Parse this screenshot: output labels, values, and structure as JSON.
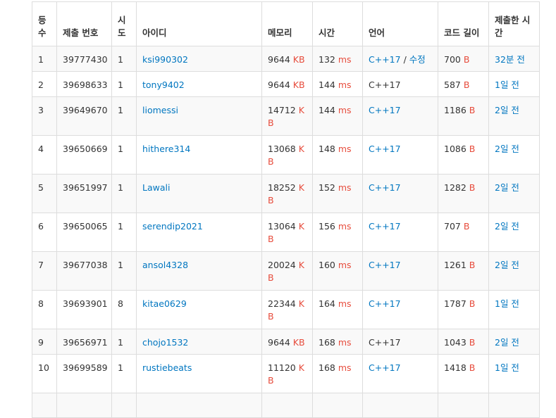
{
  "headers": [
    "등수",
    "제출 번호",
    "시도",
    "아이디",
    "메모리",
    "시간",
    "언어",
    "코드 길이",
    "제출한 시간"
  ],
  "header_lines": {
    "rank": [
      "등",
      "수"
    ],
    "attempt": [
      "시",
      "도"
    ],
    "time": [
      "제출한 시",
      "간"
    ]
  },
  "units": {
    "memory": "KB",
    "time": "ms",
    "code": "B"
  },
  "rows": [
    {
      "rank": "1",
      "submission": "39777430",
      "attempts": "1",
      "user": "ksi990302",
      "memory": "9644",
      "time": "132",
      "language": "C++17",
      "lang_linked": true,
      "edit_label": "수정",
      "code_length": "700",
      "submitted": "32분 전"
    },
    {
      "rank": "2",
      "submission": "39698633",
      "attempts": "1",
      "user": "tony9402",
      "memory": "9644",
      "time": "144",
      "language": "C++17",
      "lang_linked": false,
      "code_length": "587",
      "submitted": "1일 전"
    },
    {
      "rank": "3",
      "submission": "39649670",
      "attempts": "1",
      "user": "liomessi",
      "memory": "14712",
      "time": "144",
      "language": "C++17",
      "lang_linked": true,
      "code_length": "1186",
      "submitted": "2일 전"
    },
    {
      "rank": "4",
      "submission": "39650669",
      "attempts": "1",
      "user": "hithere314",
      "memory": "13068",
      "time": "148",
      "language": "C++17",
      "lang_linked": true,
      "code_length": "1086",
      "submitted": "2일 전"
    },
    {
      "rank": "5",
      "submission": "39651997",
      "attempts": "1",
      "user": "Lawali",
      "memory": "18252",
      "time": "152",
      "language": "C++17",
      "lang_linked": true,
      "code_length": "1282",
      "submitted": "2일 전"
    },
    {
      "rank": "6",
      "submission": "39650065",
      "attempts": "1",
      "user": "serendip2021",
      "memory": "13064",
      "time": "156",
      "language": "C++17",
      "lang_linked": true,
      "code_length": "707",
      "submitted": "2일 전"
    },
    {
      "rank": "7",
      "submission": "39677038",
      "attempts": "1",
      "user": "ansol4328",
      "memory": "20024",
      "time": "160",
      "language": "C++17",
      "lang_linked": true,
      "code_length": "1261",
      "submitted": "2일 전"
    },
    {
      "rank": "8",
      "submission": "39693901",
      "attempts": "8",
      "user": "kitae0629",
      "memory": "22344",
      "time": "164",
      "language": "C++17",
      "lang_linked": true,
      "code_length": "1787",
      "submitted": "1일 전"
    },
    {
      "rank": "9",
      "submission": "39656971",
      "attempts": "1",
      "user": "chojo1532",
      "memory": "9644",
      "time": "168",
      "language": "C++17",
      "lang_linked": false,
      "code_length": "1043",
      "submitted": "2일 전"
    },
    {
      "rank": "10",
      "submission": "39699589",
      "attempts": "1",
      "user": "rustiebeats",
      "memory": "11120",
      "time": "168",
      "language": "C++17",
      "lang_linked": true,
      "code_length": "1418",
      "submitted": "1일 전"
    },
    {
      "rank": "",
      "submission": "",
      "attempts": "",
      "user": "",
      "memory": "",
      "time": "",
      "language": "",
      "lang_linked": false,
      "code_length": "",
      "submitted": ""
    }
  ],
  "colors": {
    "link": "#0076c0",
    "unit": "#e74c3c",
    "stripe": "#f9f9f9",
    "border": "#dddddd"
  }
}
